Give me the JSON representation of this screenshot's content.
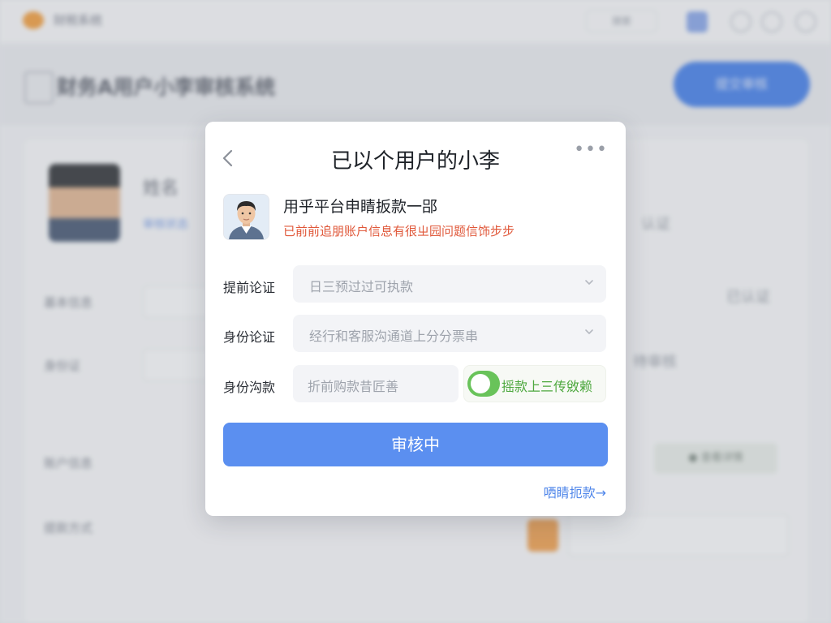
{
  "background": {
    "brand": "财税系统",
    "search": "搜索",
    "title": "财务A用户小李审核系统",
    "cta": "提交审核",
    "name": "姓名",
    "tag": "审核状态",
    "rows": [
      "基本信息",
      "身份证",
      "账户信息",
      "提款方式"
    ],
    "right_texts": [
      "认证",
      "已认证",
      "待审核"
    ],
    "pill": "●  查看详情"
  },
  "modal": {
    "title": "已以个用户的小李",
    "more": "•••",
    "user": {
      "line1": "用乎平台申睛扳款一郘",
      "line2": "已前前追朋账户信息有很ㄓ园问题信饰步步"
    },
    "form": {
      "row1": {
        "label": "提前论证",
        "value": "日三预过过可执款"
      },
      "row2": {
        "label": "身份论证",
        "value": "经行和客服沟通道上分分票串"
      },
      "row3": {
        "label": "身份沟款",
        "value": "折前购款昔匠善",
        "toggle_label": "摇款上三传敓赖",
        "toggle_on": true
      }
    },
    "primary_button": "审核中",
    "link": "哂睛扼款→"
  },
  "colors": {
    "primary": "#5b8ff0",
    "warning": "#e0583a",
    "success": "#69c35a"
  },
  "icons": [
    "back-chevron-icon",
    "more-icon",
    "chevron-down-icon",
    "toggle-switch"
  ]
}
